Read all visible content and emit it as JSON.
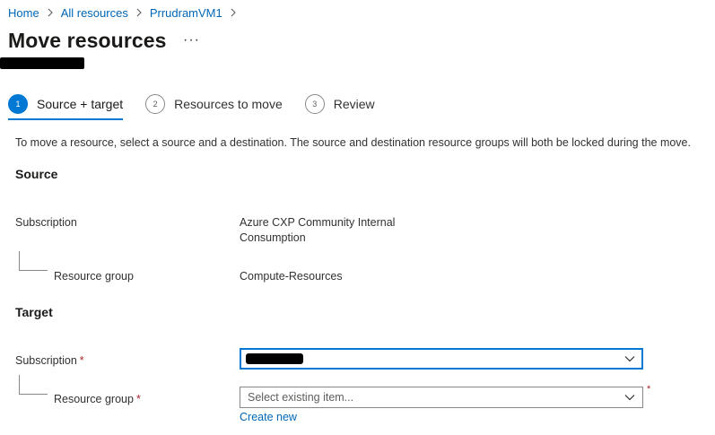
{
  "breadcrumb": {
    "items": [
      "Home",
      "All resources",
      "PrrudramVM1"
    ]
  },
  "page": {
    "title": "Move resources",
    "more": "···"
  },
  "steps": [
    {
      "num": "1",
      "label": "Source + target",
      "active": true
    },
    {
      "num": "2",
      "label": "Resources to move",
      "active": false
    },
    {
      "num": "3",
      "label": "Review",
      "active": false
    }
  ],
  "intro": "To move a resource, select a source and a destination. The source and destination resource groups will both be locked during the move.",
  "source": {
    "title": "Source",
    "subscription_label": "Subscription",
    "subscription_value_line1": "Azure CXP Community Internal",
    "subscription_value_line2": "Consumption",
    "rg_label": "Resource group",
    "rg_value": "Compute-Resources"
  },
  "target": {
    "title": "Target",
    "subscription_label": "Subscription",
    "rg_label": "Resource group",
    "required_mark": "*",
    "rg_placeholder": "Select existing item...",
    "create_new": "Create new"
  },
  "colors": {
    "accent": "#0078d4",
    "link": "#0067b8",
    "required": "#a4262c"
  }
}
